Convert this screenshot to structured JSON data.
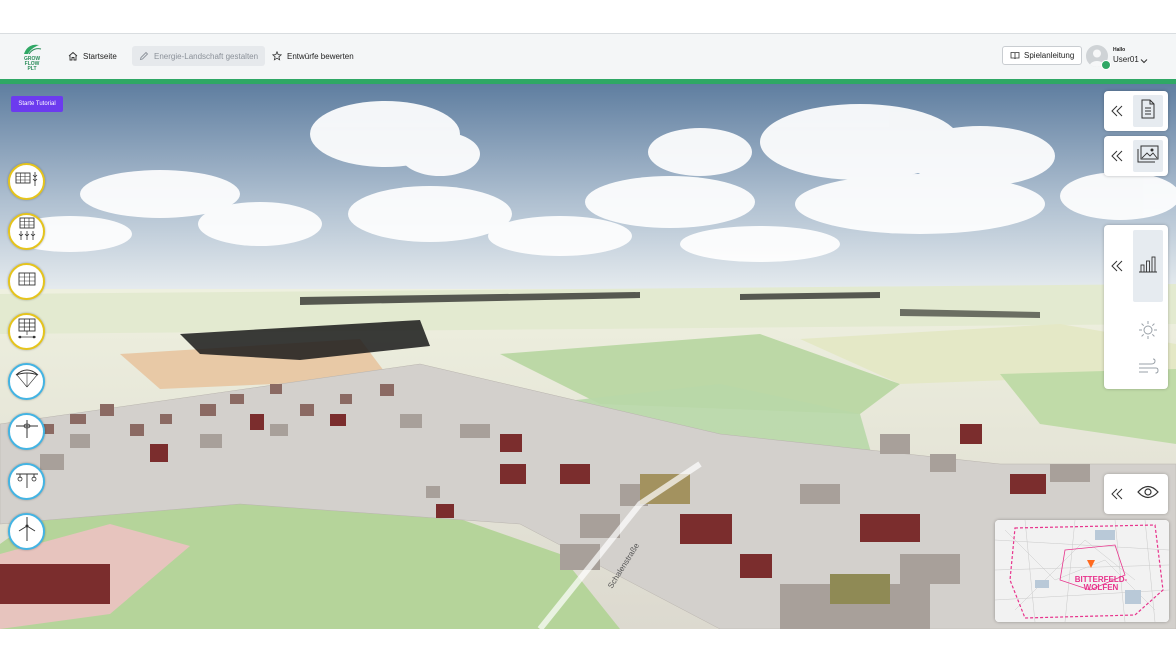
{
  "header": {
    "logo_text": "GROW\nFLOW\nPLT",
    "nav": [
      {
        "label": "Startseite",
        "icon": "home-icon",
        "active": false
      },
      {
        "label": "Energie-Landschaft gestalten",
        "icon": "pencil-icon",
        "active": true
      },
      {
        "label": "Entwürfe bewerten",
        "icon": "star-icon",
        "active": false
      }
    ],
    "guide_label": "Spielanleitung",
    "guide_icon": "book-icon",
    "user": {
      "greeting": "Hallo",
      "name": "User01",
      "status_color": "#2fa865"
    }
  },
  "scene": {
    "tutorial_label": "Starte Tutorial",
    "street_label": "Schalenstraße",
    "tools": [
      {
        "icon": "solar-panel-grain-icon",
        "ring": "yellow"
      },
      {
        "icon": "solar-panel-crops-icon",
        "ring": "yellow"
      },
      {
        "icon": "solar-panel-icon",
        "ring": "yellow"
      },
      {
        "icon": "solar-tracker-icon",
        "ring": "yellow"
      },
      {
        "icon": "paraglider-wind-icon",
        "ring": "blue"
      },
      {
        "icon": "airborne-wind-icon",
        "ring": "blue"
      },
      {
        "icon": "drone-wind-icon",
        "ring": "blue"
      },
      {
        "icon": "wind-turbine-icon",
        "ring": "blue"
      }
    ],
    "right_panels": {
      "document_icon": "document-icon",
      "image_icon": "image-icon",
      "chart_icon": "bar-chart-icon",
      "sun_icon": "sun-icon",
      "wind_icon": "wind-icon",
      "eye_icon": "eye-icon"
    },
    "minimap_label": "BITTERFELD-\nWOLFEN"
  },
  "colors": {
    "accent": "#2fa865",
    "tutorial": "#6c3bef",
    "solar_ring": "#e5c41d",
    "wind_ring": "#43b4e3",
    "map_label": "#e8338c"
  }
}
